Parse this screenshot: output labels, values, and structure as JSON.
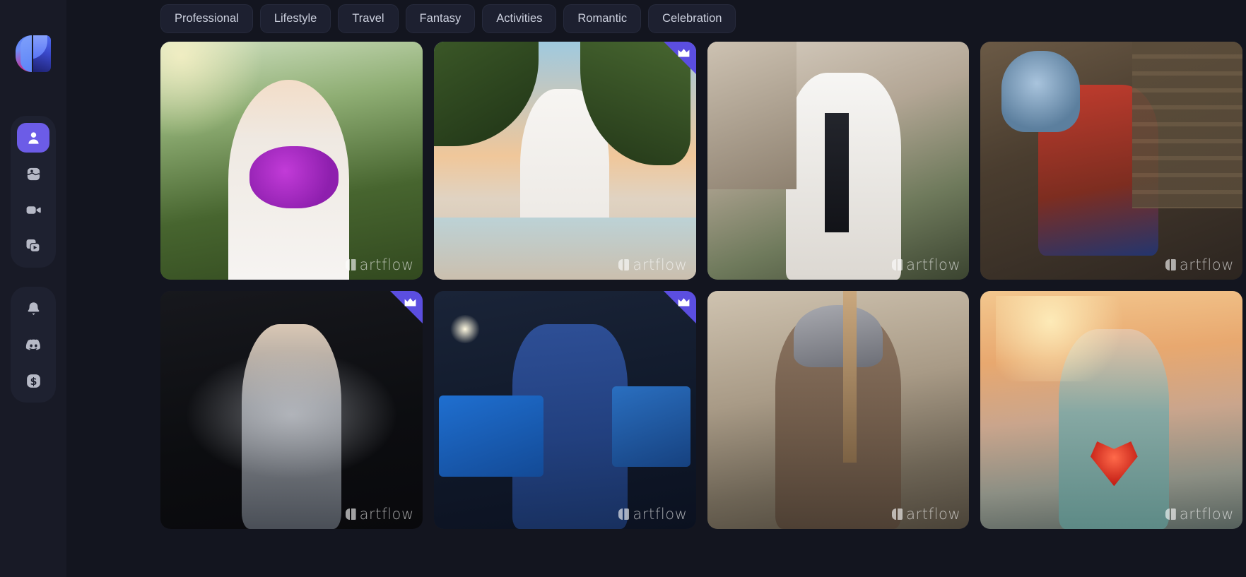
{
  "app": {
    "name": "artflow",
    "background_color": "#13151f",
    "sidebar_color": "#181a26",
    "accent_color": "#6c5ce7",
    "badge_color": "#5b4ee0"
  },
  "sidebar": {
    "logo_name": "artflow-logo",
    "primary_items": [
      {
        "icon": "person-icon",
        "name": "characters",
        "active": true
      },
      {
        "icon": "image-icon",
        "name": "images",
        "active": false
      },
      {
        "icon": "video-icon",
        "name": "videos",
        "active": false
      },
      {
        "icon": "library-icon",
        "name": "library",
        "active": false
      }
    ],
    "secondary_items": [
      {
        "icon": "bell-icon",
        "name": "notifications",
        "active": false
      },
      {
        "icon": "discord-icon",
        "name": "discord",
        "active": false
      },
      {
        "icon": "dollar-icon",
        "name": "billing",
        "active": false
      }
    ]
  },
  "tabs": [
    {
      "label": "Professional"
    },
    {
      "label": "Lifestyle"
    },
    {
      "label": "Travel"
    },
    {
      "label": "Fantasy"
    },
    {
      "label": "Activities"
    },
    {
      "label": "Romantic"
    },
    {
      "label": "Celebration"
    }
  ],
  "gallery": {
    "watermark_text": "artflow",
    "cards": [
      {
        "id": "card-1",
        "alt": "Woman in white dress holding purple flower bouquet in a garden",
        "premium": false,
        "style": "p1"
      },
      {
        "id": "card-2",
        "alt": "Woman in white shirt and shorts on a tropical beach at sunset",
        "premium": true,
        "style": "p2"
      },
      {
        "id": "card-3",
        "alt": "Man in white suit with black tie beside stone arches",
        "premium": false,
        "style": "p3"
      },
      {
        "id": "card-4",
        "alt": "Alchemist in red and blue robes working over a cauldron",
        "premium": false,
        "style": "p4"
      },
      {
        "id": "card-5",
        "alt": "Woman in flowing sheer gown surrounded by white smoke on black",
        "premium": true,
        "style": "p5"
      },
      {
        "id": "card-6",
        "alt": "Young man in blue suit on a conference stage with screens",
        "premium": true,
        "style": "p6"
      },
      {
        "id": "card-7",
        "alt": "Roman soldier in plumed helmet holding a spear on a battlefield",
        "premium": false,
        "style": "p7"
      },
      {
        "id": "card-8",
        "alt": "Smiling woman holding a glowing red heart at the beach at sunset",
        "premium": false,
        "style": "p8"
      }
    ]
  }
}
